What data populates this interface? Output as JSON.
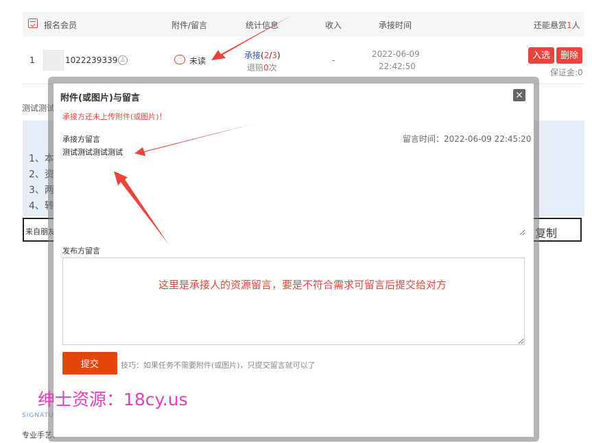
{
  "table": {
    "headers": {
      "member": "报名会员",
      "attachment": "附件/留言",
      "stats": "统计信息",
      "income": "收入",
      "time": "承接时间",
      "remaining_prefix": "还能悬赏",
      "remaining_count": "1",
      "remaining_suffix": "人"
    },
    "row": {
      "index": "1",
      "user_id": "1022239339",
      "unread": "未读",
      "accept_label": "承接",
      "accept_open": "(",
      "accept_done": "2",
      "accept_sep": "/",
      "accept_total": "3",
      "accept_close": ")",
      "refund_prefix": "退赔",
      "refund_count": "0",
      "refund_suffix": "次",
      "income": "-",
      "date": "2022-06-09",
      "time": "22:42:50",
      "select_button": "入选",
      "delete_button": "删除",
      "deposit": "保证金:0"
    }
  },
  "background": {
    "test_text": "测试测试",
    "list": [
      "1、本",
      "2、资",
      "3、两",
      "4、转"
    ],
    "input_value": "来自朋友",
    "copy_button": "复制",
    "signature": "SIGNATU",
    "craft": "专业手艺、"
  },
  "modal": {
    "title": "附件(或图片)与留言",
    "close": "×",
    "warning": "承接方还未上传附件(或图片)！",
    "taker_label": "承接方留言",
    "message_time": "留言时间：2022-06-09 22:45:20",
    "taker_message": "测试测试测试测试",
    "publisher_label": "发布方留言",
    "publisher_value": "",
    "submit": "提交",
    "tip": "技巧：如果任务不需要附件(或图片)，只提交留言就可以了"
  },
  "overlay_note": "这里是承接人的资源留言，要是不符合需求可留言后提交给对方",
  "watermark": "绅士资源：18cy.us",
  "colors": {
    "accent_red": "#e8453c",
    "submit_orange": "#e8450a",
    "watermark_pink": "#e83cbf",
    "link_blue": "#2a5bb5"
  }
}
